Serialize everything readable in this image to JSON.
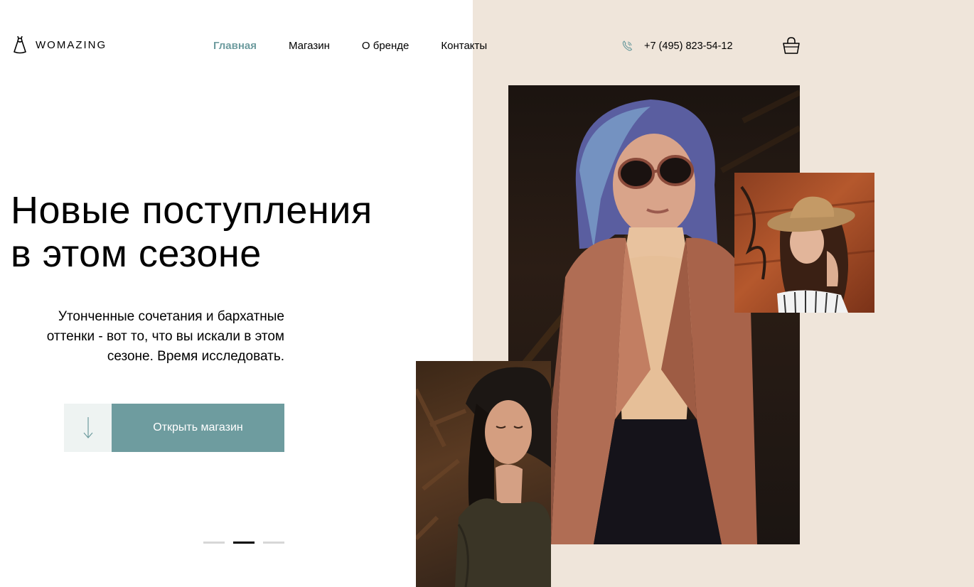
{
  "brand": {
    "name": "WOMAZING"
  },
  "nav": {
    "items": [
      {
        "label": "Главная",
        "active": true
      },
      {
        "label": "Магазин",
        "active": false
      },
      {
        "label": "О бренде",
        "active": false
      },
      {
        "label": "Контакты",
        "active": false
      }
    ]
  },
  "contact": {
    "phone": "+7 (495) 823-54-12"
  },
  "hero": {
    "title_line1": "Новые поступления",
    "title_line2": "в этом сезоне",
    "subtitle": "Утонченные сочетания и бархатные оттенки - вот то, что вы искали в этом сезоне. Время исследовать.",
    "cta_label": "Открыть магазин"
  },
  "slider": {
    "count": 3,
    "active_index": 2
  },
  "colors": {
    "accent": "#6e9c9f",
    "beige": "#efe5da",
    "arrow_bg": "#eef3f2"
  },
  "icons": [
    "dress-logo-icon",
    "phone-icon",
    "cart-icon",
    "arrow-down-icon"
  ]
}
